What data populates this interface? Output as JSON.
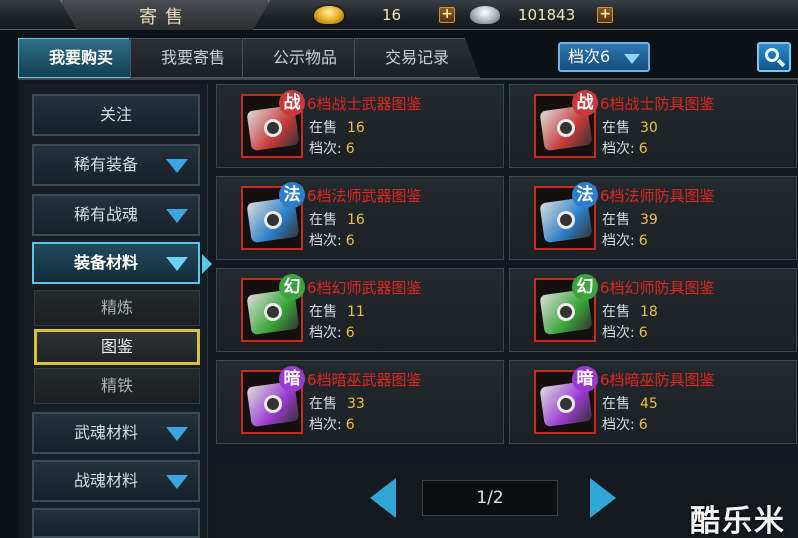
{
  "header": {
    "title": "寄售",
    "gold_value": "16",
    "silver_value": "101843",
    "gold_icon": "gold-ingot-icon",
    "silver_icon": "silver-ingot-icon"
  },
  "tabs": [
    {
      "label": "我要购买",
      "active": true
    },
    {
      "label": "我要寄售",
      "active": false
    },
    {
      "label": "公示物品",
      "active": false
    },
    {
      "label": "交易记录",
      "active": false
    }
  ],
  "grade_filter": "档次6",
  "sidebar": {
    "follow": "关注",
    "rare_equipment": "稀有装备",
    "rare_soul": "稀有战魂",
    "equip_material": "装备材料",
    "sub_refine": "精炼",
    "sub_atlas": "图鉴",
    "sub_iron": "精铁",
    "soul_material": "武魂材料",
    "war_soul_material": "战魂材料"
  },
  "labels": {
    "on_sale": "在售",
    "grade": "档次:"
  },
  "items": [
    {
      "name": "6档战士武器图鉴",
      "badge": "战",
      "on_sale": "16",
      "grade": "6",
      "color": "#c83a3a"
    },
    {
      "name": "6档战士防具图鉴",
      "badge": "战",
      "on_sale": "30",
      "grade": "6",
      "color": "#c83a3a"
    },
    {
      "name": "6档法师武器图鉴",
      "badge": "法",
      "on_sale": "16",
      "grade": "6",
      "color": "#2a7fc8"
    },
    {
      "name": "6档法师防具图鉴",
      "badge": "法",
      "on_sale": "39",
      "grade": "6",
      "color": "#2a7fc8"
    },
    {
      "name": "6档幻师武器图鉴",
      "badge": "幻",
      "on_sale": "11",
      "grade": "6",
      "color": "#3aa63a"
    },
    {
      "name": "6档幻师防具图鉴",
      "badge": "幻",
      "on_sale": "18",
      "grade": "6",
      "color": "#3aa63a"
    },
    {
      "name": "6档暗巫武器图鉴",
      "badge": "暗",
      "on_sale": "33",
      "grade": "6",
      "color": "#9a3ad0"
    },
    {
      "name": "6档暗巫防具图鉴",
      "badge": "暗",
      "on_sale": "45",
      "grade": "6",
      "color": "#9a3ad0"
    }
  ],
  "pager": {
    "text": "1/2"
  },
  "watermark": "酷乐米"
}
